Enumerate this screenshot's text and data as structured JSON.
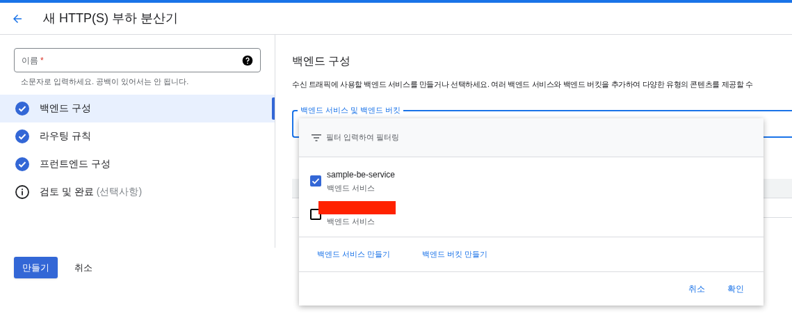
{
  "header": {
    "title": "새 HTTP(S) 부하 분산기"
  },
  "name_field": {
    "label": "이름",
    "required_mark": "*",
    "hint": "소문자로 입력하세요. 공백이 있어서는 안 됩니다."
  },
  "steps": [
    {
      "label": "백엔드 구성",
      "done": true,
      "selected": true
    },
    {
      "label": "라우팅 규칙",
      "done": true,
      "selected": false
    },
    {
      "label": "프런트엔드 구성",
      "done": true,
      "selected": false
    },
    {
      "label": "검토 및 완료",
      "suffix": "(선택사항)",
      "done": false,
      "selected": false
    }
  ],
  "actions": {
    "create": "만들기",
    "cancel": "취소"
  },
  "section": {
    "title": "백엔드 구성",
    "description": "수신 트래픽에 사용할 백엔드 서비스를 만들거나 선택하세요. 여러 백엔드 서비스와 백엔드 버킷을 추가하여 다양한 유형의 콘텐츠를 제공할 수"
  },
  "select_field": {
    "label": "백엔드 서비스 및 백엔드 버킷"
  },
  "dropdown": {
    "filter": {
      "placeholder": "필터 입력하여 필터링"
    },
    "options": [
      {
        "name": "sample-be-service",
        "type": "백엔드 서비스",
        "checked": true,
        "redacted": false
      },
      {
        "type": "백엔드 서비스",
        "checked": false,
        "redacted": true
      }
    ],
    "links": [
      "백엔드 서비스 만들기",
      "백엔드 버킷 만들기"
    ],
    "buttons": [
      "취소",
      "확인"
    ]
  }
}
